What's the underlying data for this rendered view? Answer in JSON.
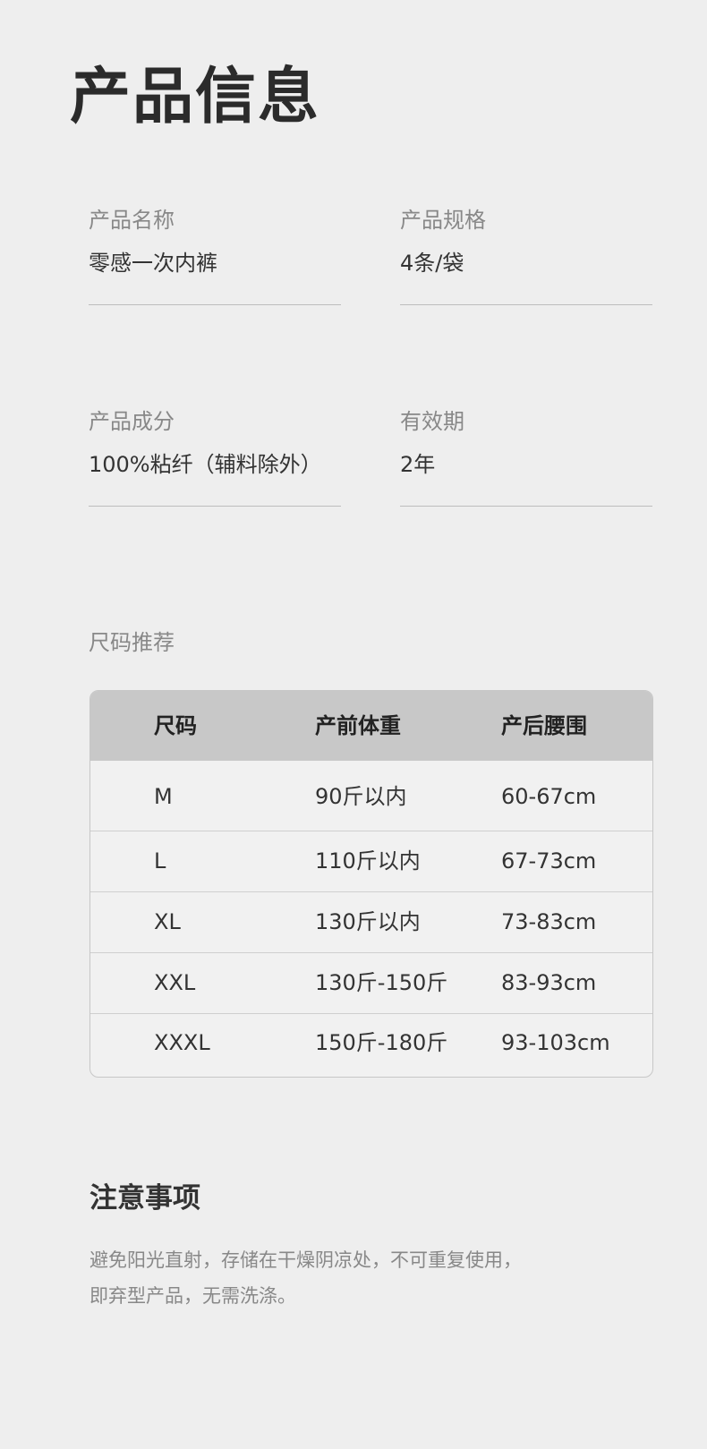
{
  "header": {
    "title": "产品信息"
  },
  "info": {
    "name": {
      "label": "产品名称",
      "value": "零感一次内裤"
    },
    "spec": {
      "label": "产品规格",
      "value": "4条/袋"
    },
    "composition": {
      "label": "产品成分",
      "value": "100%粘纤（辅料除外）"
    },
    "validity": {
      "label": "有效期",
      "value": "2年"
    }
  },
  "size_section": {
    "label": "尺码推荐",
    "headers": [
      "尺码",
      "产前体重",
      "产后腰围"
    ],
    "rows": [
      [
        "M",
        "90斤以内",
        "60-67cm"
      ],
      [
        "L",
        "110斤以内",
        "67-73cm"
      ],
      [
        "XL",
        "130斤以内",
        "73-83cm"
      ],
      [
        "XXL",
        "130斤-150斤",
        "83-93cm"
      ],
      [
        "XXXL",
        "150斤-180斤",
        "93-103cm"
      ]
    ]
  },
  "notice": {
    "title": "注意事项",
    "line1": "避免阳光直射，存储在干燥阴凉处，不可重复使用，",
    "line2": "即弃型产品，无需洗涤。"
  },
  "colors": {
    "background": "#eeeeee",
    "table_header": "#c8c8c8",
    "label_gray": "#888888",
    "text_dark": "#333333"
  }
}
